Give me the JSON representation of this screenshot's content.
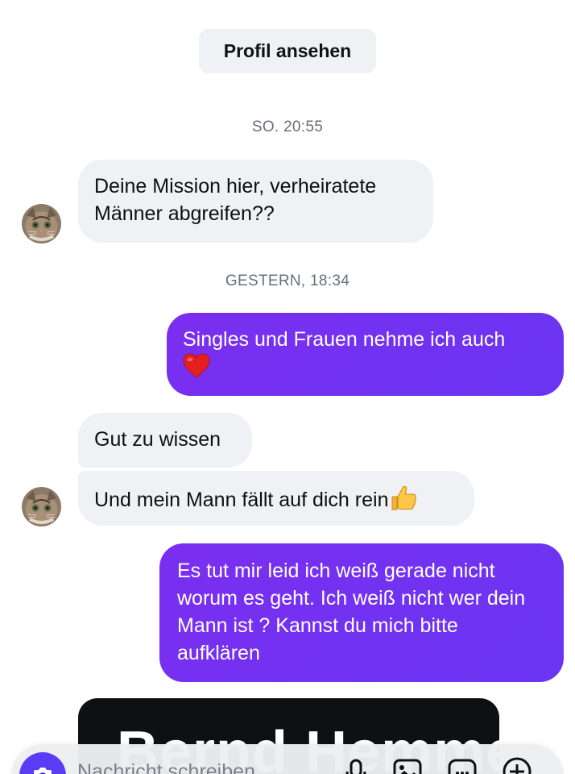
{
  "header": {
    "profile_button_label": "Profil ansehen"
  },
  "colors": {
    "incoming_bubble": "#eff1f4",
    "outgoing_bubble": "#7b2ef0",
    "accent": "#5a3cf4",
    "timestamp_text": "#66707c"
  },
  "conversation": {
    "timestamp_1": "SO. 20:55",
    "message_1": "Deine Mission hier, verheiratete Männer abgreifen??",
    "timestamp_2": "GESTERN, 18:34",
    "message_2": "Singles und Frauen nehme ich auch",
    "message_2_emoji": "red-heart-emoji",
    "message_3": "Gut zu wissen",
    "message_4": "Und mein Mann fällt auf dich rein",
    "message_4_emoji": "thumbs-up-emoji",
    "message_5": "Es tut mir leid ich weiß gerade nicht worum es geht. Ich weiß nicht wer dein Mann ist ? Kannst du mich bitte aufklären",
    "media_preview_text": "Bernd Hemme"
  },
  "composer": {
    "placeholder": "Nachricht schreiben",
    "icons": [
      "camera-icon",
      "microphone-icon",
      "image-icon",
      "sticker-icon",
      "plus-icon"
    ]
  }
}
